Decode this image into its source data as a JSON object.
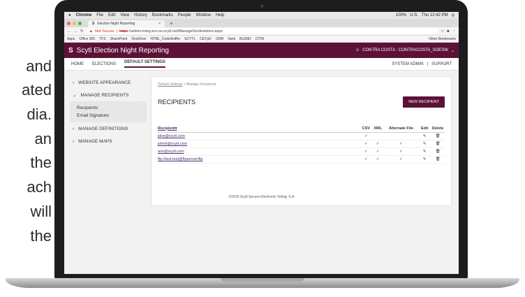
{
  "slide_text": [
    "and",
    "ated",
    "dia.",
    "an",
    "the",
    "ach",
    "will",
    "the"
  ],
  "menubar": {
    "items": [
      "Chrome",
      "File",
      "Edit",
      "View",
      "History",
      "Bookmarks",
      "People",
      "Window",
      "Help"
    ],
    "status": [
      "100%",
      "U.S.",
      "Thu 12:42 PM"
    ]
  },
  "browser": {
    "tab_title": "Election Night Reporting",
    "new_tab": "+",
    "not_secure": "Not Secure",
    "url_scheme": "https",
    "url_rest": "://admin.integ.enr.us.scytl.net/ManageDestinations.aspx",
    "bookmarks": [
      "Apps",
      "Office 365",
      "TFS",
      "SharePoint",
      "OneDrive",
      "HTML_CodeSniffer",
      "SCYTL",
      "CETpD",
      "CRM",
      "Varis",
      "BLEND",
      "CITM"
    ],
    "other_bookmarks": "Other Bookmarks"
  },
  "app": {
    "title": "Scytl Election Night Reporting",
    "user": "CONTRA COSTA : CONTRACOSTA_SOESW",
    "nav": [
      "HOME",
      "ELECTIONS",
      "DEFAULT SETTINGS"
    ],
    "nav_right": [
      "SYSTEM ADMIN",
      "|",
      "SUPPORT"
    ]
  },
  "sidebar": {
    "website_appearance": "WEBSITE APPEARANCE",
    "manage_recipients": "MANAGE RECIPIENTS",
    "sub": [
      "Recipients",
      "Email Signature"
    ],
    "manage_definitions": "MANAGE DEFINITIONS",
    "manage_maps": "MANAGE MAPS"
  },
  "main": {
    "crumb_link": "Default Settings",
    "crumb_sep": "»",
    "crumb_current": "Manage Recipients",
    "title": "RECIPIENTS",
    "new_button": "NEW RECIPIENT",
    "columns": [
      "Recipient▾",
      "CSV",
      "XML",
      "Alternate File",
      "Edit",
      "Delete"
    ],
    "rows": [
      {
        "recipient": "jdoe@scytl.com",
        "csv": "✓",
        "xml": "",
        "alt": ""
      },
      {
        "recipient": "johnd@scytl.com",
        "csv": "✓",
        "xml": "✓",
        "alt": "✓"
      },
      {
        "recipient": "ann@scytl.com",
        "csv": "✓",
        "xml": "✓",
        "alt": "✓"
      },
      {
        "recipient": "ftp://test:test@ftpserver/ftp",
        "csv": "✓",
        "xml": "✓",
        "alt": "✓"
      }
    ]
  },
  "footer": "©2019 Scytl Secure Electronic Voting, S.A",
  "colors": {
    "brand": "#5c1236"
  }
}
